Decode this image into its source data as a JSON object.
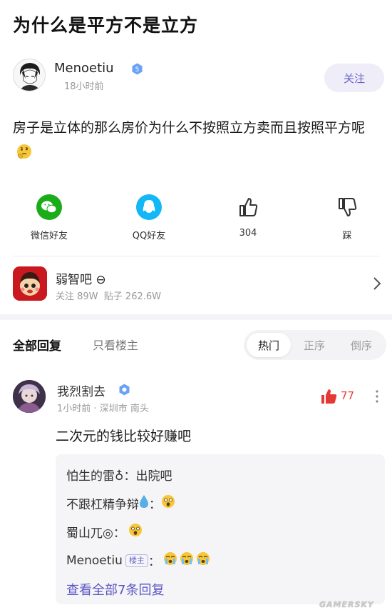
{
  "post": {
    "title": "为什么是平方不是立方",
    "author": {
      "name": "Menoetiu",
      "time": "18小时前",
      "badge": "5"
    },
    "follow_label": "关注",
    "content": "房子是立体的那么房价为什么不按照立方卖而且按照平方呢",
    "content_emoji": "thinking-face"
  },
  "actions": {
    "wechat_label": "微信好友",
    "qq_label": "QQ好友",
    "like_count": "304",
    "dislike_label": "踩"
  },
  "forum": {
    "name": "弱智吧",
    "name_icon": "⊖",
    "followers": "关注 89W",
    "posts": "贴子 262.6W"
  },
  "tabs": {
    "all_label": "全部回复",
    "op_only_label": "只看楼主",
    "sort_options": [
      "热门",
      "正序",
      "倒序"
    ],
    "active_sort": "热门"
  },
  "reply": {
    "name": "我烈割去",
    "time": "1小时前",
    "location": "深圳市 南头",
    "likes": "77",
    "text": "二次元的钱比较好赚吧",
    "sub_replies": [
      {
        "name": "怕生的雷♁",
        "sep": "：",
        "text": "出院吧"
      },
      {
        "name": "不跟杠精争辩",
        "sep": "：",
        "text": ""
      },
      {
        "name": "蜀山兀◎",
        "sep": "：",
        "text": ""
      },
      {
        "name": "Menoetiu",
        "tag": "楼主",
        "sep": "：",
        "text": ""
      }
    ],
    "see_all": "查看全部7条回复"
  },
  "watermark": "GAMERSKY",
  "colors": {
    "accent": "#6a63c9",
    "like_red": "#e53935",
    "wechat_green": "#1aad19",
    "qq_blue": "#12b7f5"
  }
}
